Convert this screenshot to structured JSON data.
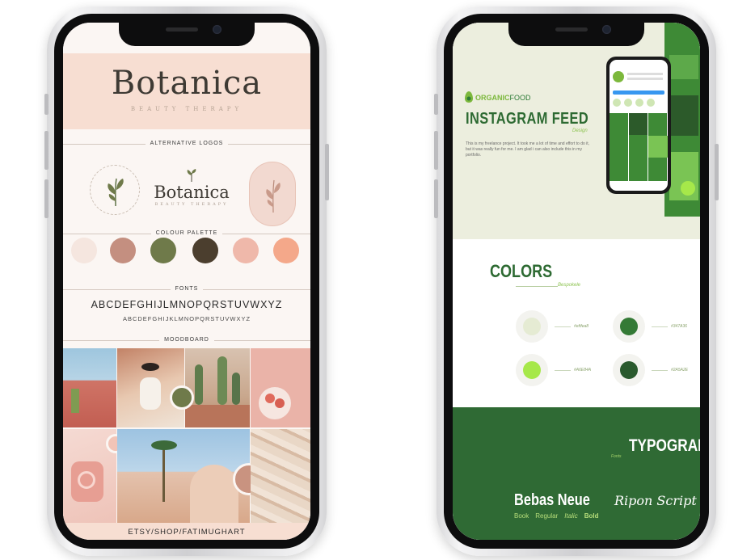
{
  "left_phone": {
    "brand_title": "Botanica",
    "brand_subtitle": "BEAUTY THERAPY",
    "alt_logos_label": "ALTERNATIVE LOGOS",
    "logo_variant_title": "Botanica",
    "logo_variant_subtitle": "BEAUTY THERAPY",
    "palette_label": "COLOUR PALETTE",
    "palette": [
      "#f5e6df",
      "#c48f80",
      "#6f7a4a",
      "#4b3e2e",
      "#efb8aa",
      "#f4a88a"
    ],
    "fonts_label": "FONTS",
    "font_sample_bold": "ABCDEFGHIJLMNOPQRSTUVWXYZ",
    "font_sample_light": "ABCDEFGHIJKLMNOPQRSTUVWXYZ",
    "moodboard_label": "MOODBOARD",
    "footer": "ETSY/SHOP/FATIMUGHART"
  },
  "right_phone": {
    "brand_prefix": "ORGANIC",
    "brand_suffix": "FOOD",
    "instagram_heading": "INSTAGRAM FEED",
    "instagram_tag": "Design",
    "instagram_text": "This is my freelance project. It took me a lot of time and effort to do it, but it was really fun for me. I am glad i can also include this in my portfolio.",
    "colors_heading": "COLORS",
    "colors_tag": "Bespokele",
    "colors": [
      {
        "swatch": "#e5ebd3",
        "hex": "#eftfea8"
      },
      {
        "swatch": "#347a36",
        "hex": "#347A36"
      },
      {
        "swatch": "#a6e84a",
        "hex": "#A6E84A"
      },
      {
        "swatch": "#2a5a2e",
        "hex": "#2A5A2E"
      }
    ],
    "typography_heading": "TYPOGRAP",
    "typography_tag": "Fonts",
    "font_primary": "Bebas Neue",
    "font_weights": [
      "Book",
      "Regular",
      "Italic",
      "Bold"
    ],
    "font_secondary": "Ripon Script"
  }
}
